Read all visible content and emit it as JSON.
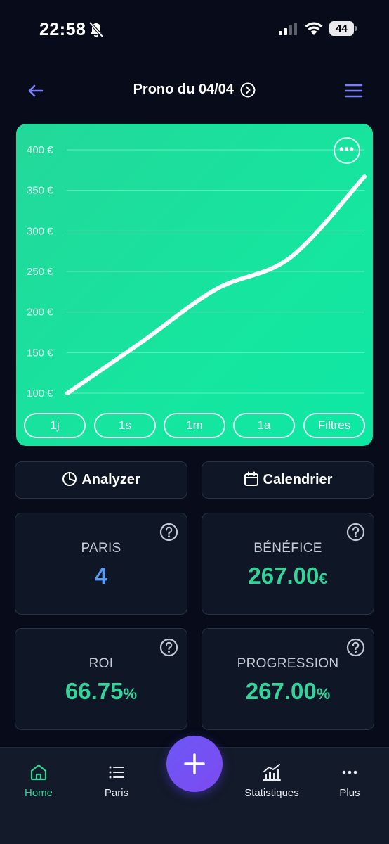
{
  "status": {
    "time": "22:58",
    "battery": "44"
  },
  "header": {
    "title": "Prono du 04/04"
  },
  "chart_data": {
    "type": "line",
    "title": "",
    "y_tick_labels": [
      "400 €",
      "350 €",
      "300 €",
      "250 €",
      "200 €",
      "150 €",
      "100 €"
    ],
    "y_ticks": [
      400,
      350,
      300,
      250,
      200,
      150,
      100
    ],
    "ylim": [
      100,
      400
    ],
    "grid": true,
    "series": [
      {
        "values": [
          100,
          163,
          228,
          267,
          367
        ]
      }
    ],
    "line_color": "#ffffff",
    "background": "#16e59f"
  },
  "chart_ranges": [
    "1j",
    "1s",
    "1m",
    "1a",
    "Filtres"
  ],
  "actions": {
    "analyzer": "Analyzer",
    "calendar": "Calendrier"
  },
  "stats": {
    "paris": {
      "label": "PARIS",
      "value": "4",
      "color": "#5b9cf0"
    },
    "benefice": {
      "label": "BÉNÉFICE",
      "value": "267.00",
      "unit": "€",
      "color": "#34d399"
    },
    "roi": {
      "label": "ROI",
      "value": "66.75",
      "unit": "%",
      "color": "#34d399"
    },
    "progression": {
      "label": "PROGRESSION",
      "value": "267.00",
      "unit": "%",
      "color": "#34d399"
    }
  },
  "nav": {
    "home": "Home",
    "paris": "Paris",
    "statistiques": "Statistiques",
    "plus": "Plus"
  },
  "colors": {
    "accent": "#34d399",
    "fab": "#6d56f5",
    "background": "#070b1a"
  }
}
